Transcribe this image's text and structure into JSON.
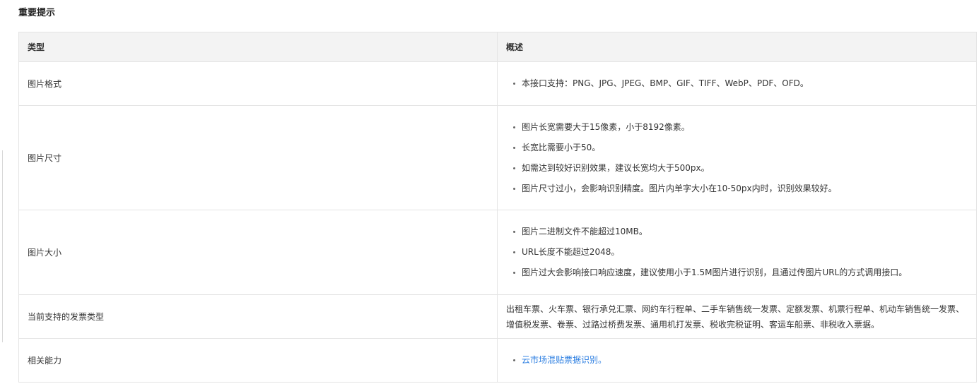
{
  "section": {
    "title": "重要提示"
  },
  "table": {
    "headers": {
      "type": "类型",
      "desc": "概述"
    },
    "rows": {
      "format": {
        "type": "图片格式",
        "items": [
          "本接口支持：PNG、JPG、JPEG、BMP、GIF、TIFF、WebP、PDF、OFD。"
        ]
      },
      "dimension": {
        "type": "图片尺寸",
        "items": [
          "图片长宽需要大于15像素，小于8192像素。",
          "长宽比需要小于50。",
          "如需达到较好识别效果，建议长宽均大于500px。",
          "图片尺寸过小，会影响识别精度。图片内单字大小在10-50px内时，识别效果较好。"
        ]
      },
      "size": {
        "type": "图片大小",
        "items": [
          "图片二进制文件不能超过10MB。",
          "URL长度不能超过2048。",
          "图片过大会影响接口响应速度，建议使用小于1.5M图片进行识别，且通过传图片URL的方式调用接口。"
        ]
      },
      "invoice": {
        "type": "当前支持的发票类型",
        "text": "出租车票、火车票、银行承兑汇票、网约车行程单、二手车销售统一发票、定额发票、机票行程单、机动车销售统一发票、增值税发票、卷票、过路过桥费发票、通用机打发票、税收完税证明、客运车船票、非税收入票据。"
      },
      "related": {
        "type": "相关能力",
        "link": "云市场混贴票据识别。"
      }
    }
  },
  "colors": {
    "header_bg": "#f3f3f3",
    "border": "#e4e4e4",
    "link": "#2a7de1",
    "text": "#333333"
  }
}
